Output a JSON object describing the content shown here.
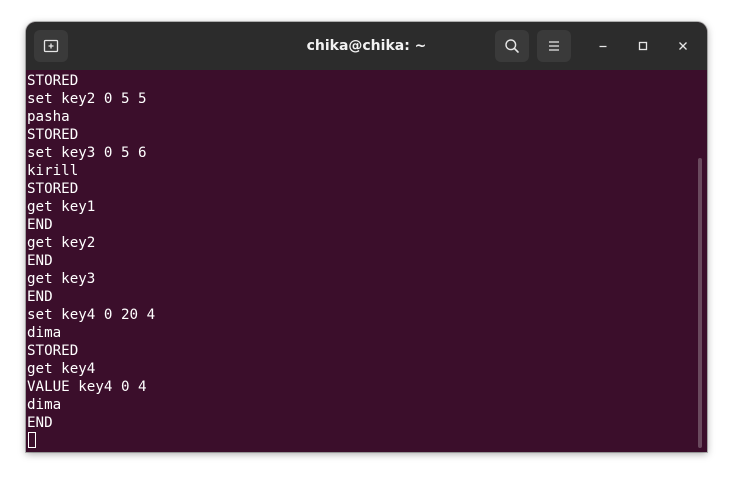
{
  "window": {
    "title": "chika@chika: ~"
  },
  "titlebar": {
    "icons": {
      "new_tab": "new-tab-icon",
      "search": "search-icon",
      "menu": "hamburger-menu-icon",
      "minimize": "minimize-icon",
      "maximize": "maximize-icon",
      "close": "close-icon"
    }
  },
  "terminal": {
    "lines": [
      "STORED",
      "set key2 0 5 5",
      "pasha",
      "STORED",
      "set key3 0 5 6",
      "kirill",
      "STORED",
      "get key1",
      "END",
      "get key2",
      "END",
      "get key3",
      "END",
      "set key4 0 20 4",
      "dima",
      "STORED",
      "get key4",
      "VALUE key4 0 4",
      "dima",
      "END"
    ]
  },
  "colors": {
    "terminal_bg": "#3b0e2b",
    "titlebar_bg": "#2c2c2c",
    "text": "#ffffff"
  }
}
